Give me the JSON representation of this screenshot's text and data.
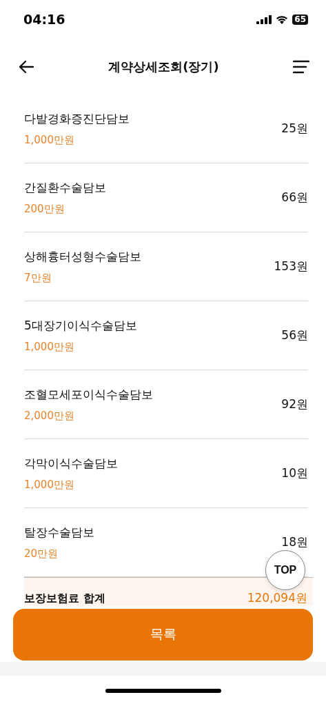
{
  "status_bar": {
    "time": "04:16",
    "battery": "65"
  },
  "header": {
    "title": "계약상세조회(장기)"
  },
  "coverages": [
    {
      "name": "다발경화증진단담보",
      "amount": "1,000만원",
      "premium": "25원"
    },
    {
      "name": "간질환수술담보",
      "amount": "200만원",
      "premium": "66원"
    },
    {
      "name": "상해흉터성형수술담보",
      "amount": "7만원",
      "premium": "153원"
    },
    {
      "name": "5대장기이식수술담보",
      "amount": "1,000만원",
      "premium": "56원"
    },
    {
      "name": "조혈모세포이식수술담보",
      "amount": "2,000만원",
      "premium": "92원"
    },
    {
      "name": "각막이식수술담보",
      "amount": "1,000만원",
      "premium": "10원"
    },
    {
      "name": "탈장수술담보",
      "amount": "20만원",
      "premium": "18원"
    }
  ],
  "total": {
    "label": "보장보험료 합계",
    "value": "120,094원"
  },
  "top_button": "TOP",
  "list_button": "목록"
}
